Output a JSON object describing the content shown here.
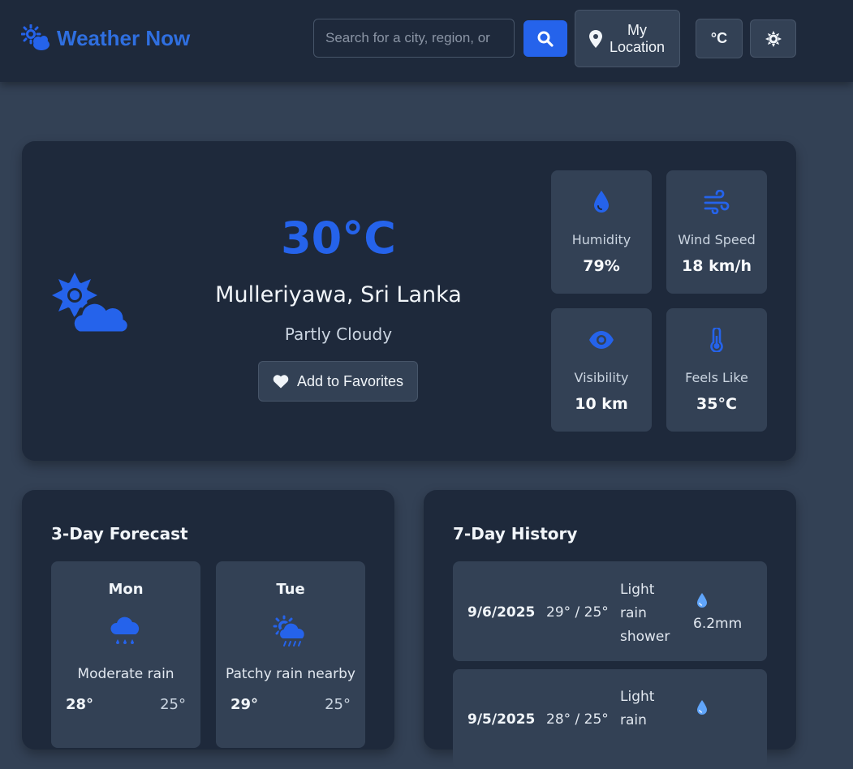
{
  "app": {
    "name": "Weather Now"
  },
  "header": {
    "search_placeholder": "Search for a city, region, or",
    "my_location_label": "My Location",
    "unit_label": "°C"
  },
  "current": {
    "temperature": "30°C",
    "location": "Mulleriyawa, Sri Lanka",
    "condition": "Partly Cloudy",
    "favorite_label": "Add to Favorites",
    "stats": [
      {
        "label": "Humidity",
        "value": "79%",
        "icon": "droplet-icon"
      },
      {
        "label": "Wind Speed",
        "value": "18 km/h",
        "icon": "wind-icon"
      },
      {
        "label": "Visibility",
        "value": "10 km",
        "icon": "eye-icon"
      },
      {
        "label": "Feels Like",
        "value": "35°C",
        "icon": "thermometer-icon"
      }
    ]
  },
  "forecast": {
    "title": "3-Day Forecast",
    "days": [
      {
        "day": "Mon",
        "condition": "Moderate rain",
        "max": "28°",
        "min": "25°",
        "icon": "cloud-rain-icon"
      },
      {
        "day": "Tue",
        "condition": "Patchy rain nearby",
        "max": "29°",
        "min": "25°",
        "icon": "sun-cloud-rain-icon"
      }
    ]
  },
  "history": {
    "title": "7-Day History",
    "rows": [
      {
        "date": "9/6/2025",
        "temps": "29° / 25°",
        "condition": "Light rain shower",
        "precip": "6.2mm"
      },
      {
        "date": "9/5/2025",
        "temps": "28° / 25°",
        "condition": "Light rain",
        "precip": ""
      }
    ]
  },
  "colors": {
    "accent": "#2563eb",
    "background": "#334155",
    "card": "#1e293b"
  }
}
